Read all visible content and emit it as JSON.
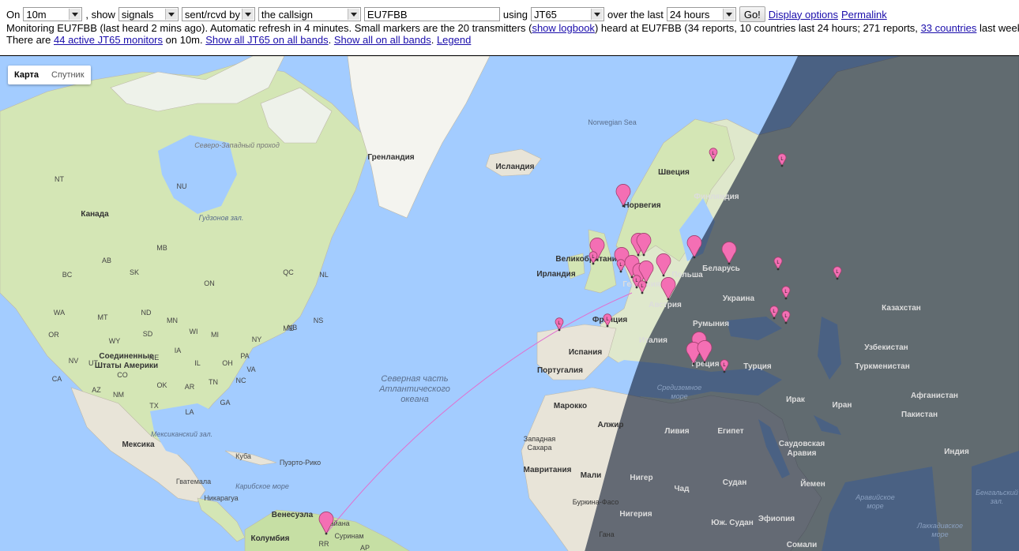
{
  "controls": {
    "on_label": "On",
    "band": "10m",
    "show_label": ", show",
    "show_value": "signals",
    "direction": "sent/rcvd by",
    "target": "the callsign",
    "callsign": "EU7FBB",
    "using_label": "using",
    "mode": "JT65",
    "over_label": "over the last",
    "period": "24 hours",
    "go_label": "Go!",
    "display_options": "Display options",
    "permalink": "Permalink"
  },
  "status": {
    "line1_a": "Monitoring EU7FBB (last heard 2 mins ago). Automatic refresh in 4 minutes. Small markers are the 20 transmitters (",
    "show_logbook": "show logbook",
    "line1_b": ") heard at EU7FBB (34 reports, 10 countries last 24 hours; 271 reports,",
    "countries_link": "33 countries",
    "line1_c": "last week).",
    "line2_a": "There are",
    "active_link": "44 active JT65 monitors",
    "line2_b": "on 10m.",
    "all_jt65_link": "Show all JT65 on all bands",
    "all_link": "Show all on all bands",
    "legend_link": "Legend"
  },
  "map": {
    "map_button": "Карта",
    "satellite_button": "Спутник",
    "colors": {
      "water": "#a3ccff",
      "land": "#e8e4d8",
      "green": "#c6dfa4",
      "night": "rgba(20,30,55,0.62)",
      "marker": "#f46fb4",
      "path": "#e070d0"
    },
    "labels": {
      "nw_passage": "Северо-Западный проход",
      "greenland": "Гренландия",
      "iceland": "Исландия",
      "norwegian_sea": "Norwegian Sea",
      "sweden": "Швеция",
      "finland": "Финляндия",
      "norway": "Норвегия",
      "canada": "Канада",
      "hudson_bay": "Гудзонов зал.",
      "nt": "NT",
      "nu": "NU",
      "bc": "BC",
      "ab": "AB",
      "sk": "SK",
      "mb": "MB",
      "on": "ON",
      "qc": "QC",
      "nl": "NL",
      "nb": "NB",
      "ns": "NS",
      "usa_1": "Соединенные",
      "usa_2": "Штаты Америки",
      "wa": "WA",
      "or": "OR",
      "mt": "MT",
      "nd": "ND",
      "mn": "MN",
      "wi": "WI",
      "mi": "MI",
      "ny": "NY",
      "me": "ME",
      "wy": "WY",
      "sd": "SD",
      "ia": "IA",
      "pa": "PA",
      "nv": "NV",
      "ut": "UT",
      "co": "CO",
      "ne": "NE",
      "il": "IL",
      "oh": "OH",
      "va": "VA",
      "ca": "CA",
      "az": "AZ",
      "nm": "NM",
      "ok": "OK",
      "ar": "AR",
      "tn": "TN",
      "nc": "NC",
      "tx": "TX",
      "la": "LA",
      "ga": "GA",
      "mexico": "Мексика",
      "gulf_mexico": "Мексиканский зал.",
      "cuba": "Куба",
      "puerto_rico": "Пуэрто-Рико",
      "guatemala": "Гватемала",
      "nicaragua": "Никарагуа",
      "caribbean": "Карибское море",
      "venezuela": "Венесуэла",
      "colombia": "Колумбия",
      "guyana": "Гайана",
      "suriname": "Суринам",
      "rr": "RR",
      "ap": "AP",
      "atlantic_1": "Северная часть",
      "atlantic_2": "Атлантического",
      "atlantic_3": "океана",
      "uk": "Великобритания",
      "ireland": "Ирландия",
      "germany": "Германия",
      "poland": "Польша",
      "belarus": "Беларусь",
      "ukraine": "Украина",
      "france": "Франция",
      "austria": "Австрия",
      "romania": "Румыния",
      "italy": "Италия",
      "spain": "Испания",
      "portugal": "Португалия",
      "greece": "Греция",
      "turkey": "Турция",
      "kazakhstan": "Казахстан",
      "uzbekistan": "Узбекистан",
      "turkmenistan": "Туркменистан",
      "afghanistan": "Афганистан",
      "pakistan": "Пакистан",
      "iran": "Иран",
      "iraq": "Ирак",
      "morocco": "Марокко",
      "algeria": "Алжир",
      "libya": "Ливия",
      "egypt": "Египет",
      "saudi_1": "Саудовская",
      "saudi_2": "Аравия",
      "india": "Индия",
      "western_sahara_1": "Западная",
      "western_sahara_2": "Сахара",
      "mauritania": "Мавритания",
      "mali": "Мали",
      "niger": "Нигер",
      "chad": "Чад",
      "sudan": "Судан",
      "yemen": "Йемен",
      "arabian_sea_1": "Аравийское",
      "arabian_sea_2": "море",
      "burkina": "Буркина-Фасо",
      "nigeria": "Нигерия",
      "ethiopia": "Эфиопия",
      "south_sudan": "Юж. Судан",
      "somalia": "Сомали",
      "ghana": "Гана",
      "mediterranean_1": "Средиземное",
      "mediterranean_2": "море",
      "bay_bengal_1": "Бенгальский",
      "bay_bengal_2": "зал.",
      "laccadive_1": "Лаккадивское",
      "laccadive_2": "море",
      "marker_letter": "L"
    }
  }
}
